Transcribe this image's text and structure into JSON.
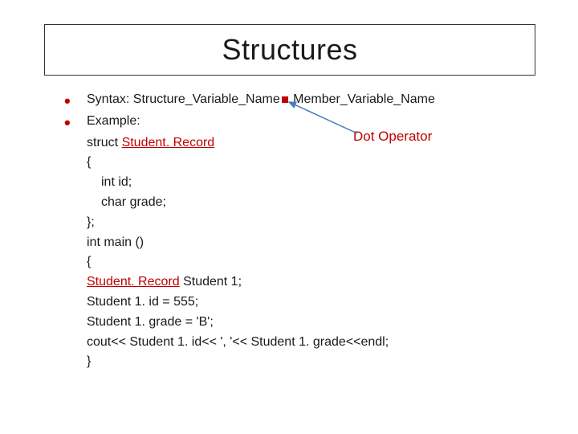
{
  "title": "Structures",
  "bullets": {
    "syntax_label": "Syntax: Structure_Variable_Name",
    "syntax_tail": " Member_Variable_Name",
    "example_label": "Example:"
  },
  "annotation": {
    "dot_operator": "Dot Operator"
  },
  "code": {
    "l1a": "struct ",
    "l1b": "Student. Record",
    "l2": "{",
    "l3": "int id;",
    "l4": "char grade;",
    "l5": "};",
    "l6": "int main ()",
    "l7": "{",
    "l8a": "Student. Record",
    "l8b": "   Student 1;",
    "l9": "Student 1. id             = 555;",
    "l10": "Student 1. grade  = 'B';",
    "l11": "cout<< Student 1. id<< ', '<< Student 1. grade<<endl;",
    "l12": "}"
  }
}
